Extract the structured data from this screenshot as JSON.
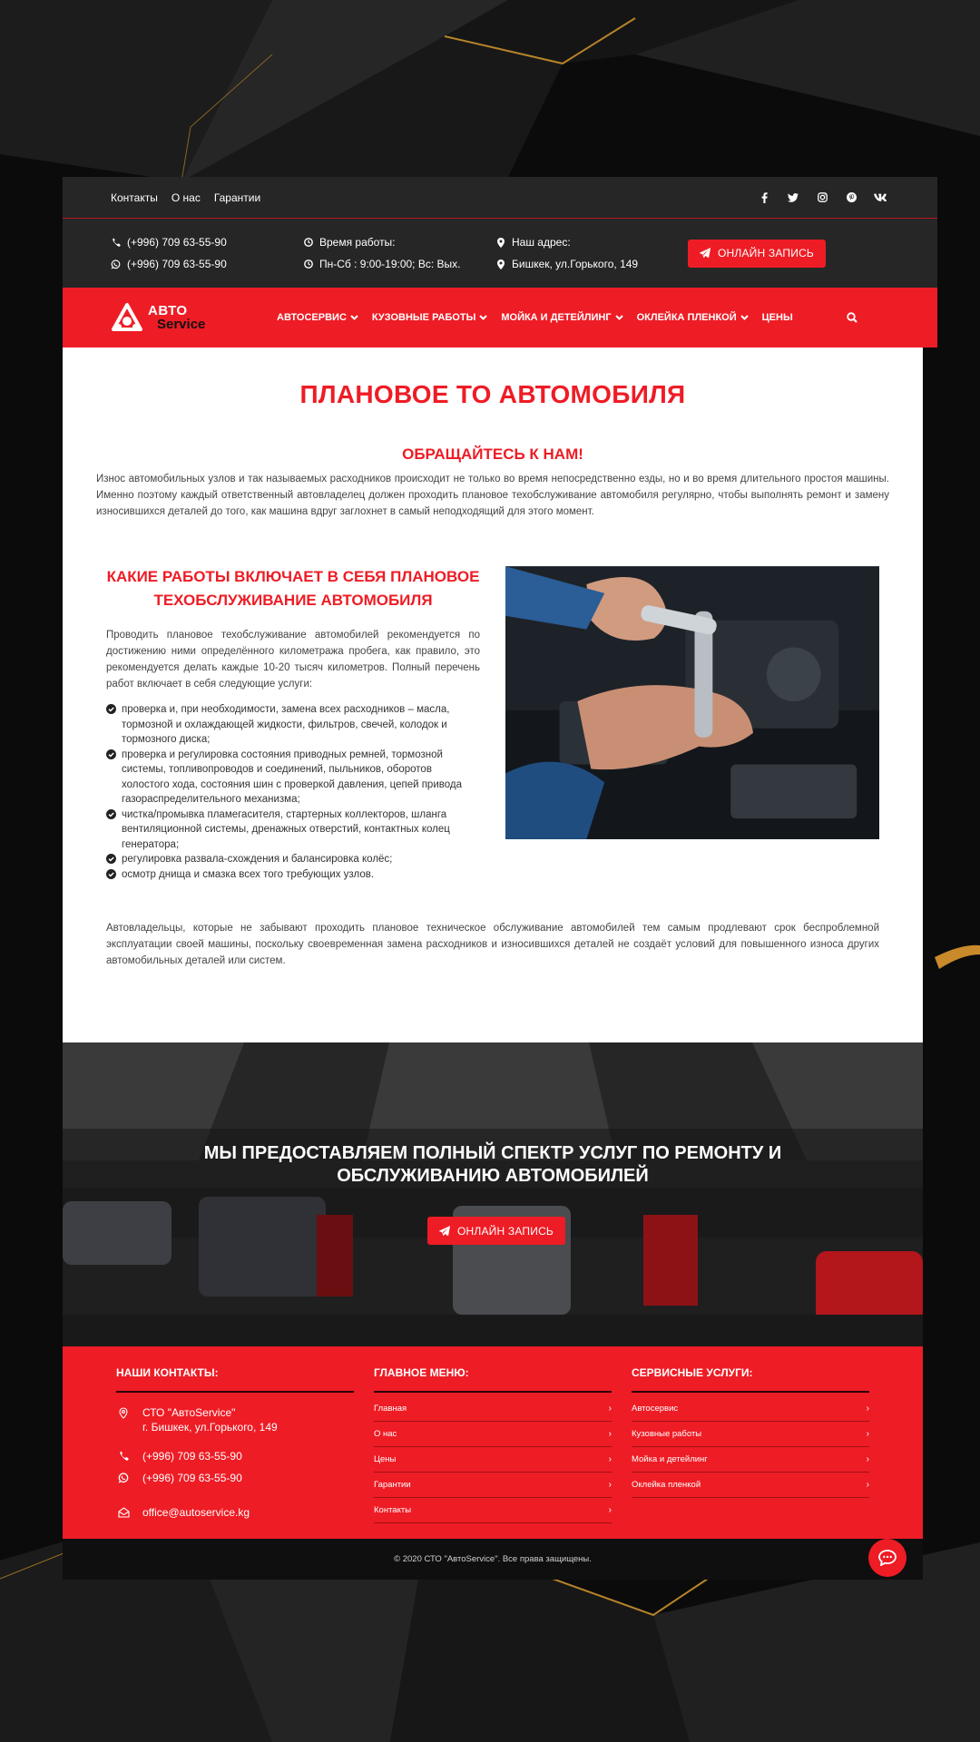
{
  "topbar": {
    "links": [
      "Контакты",
      "О нас",
      "Гарантии"
    ],
    "socials": [
      "facebook-icon",
      "twitter-icon",
      "instagram-icon",
      "pinterest-icon",
      "vk-icon"
    ]
  },
  "info": {
    "phone1": "(+996) 709 63-55-90",
    "phone2": "(+996) 709 63-55-90",
    "hours_label": "Время работы:",
    "hours_value": "Пн-Сб : 9:00-19:00; Вс: Вых.",
    "address_label": "Наш адрес:",
    "address_value": "Бишкек, ул.Горького, 149",
    "booking_button": "ОНЛАЙН ЗАПИСЬ"
  },
  "logo": {
    "line1": "АВТО",
    "line2": "Service"
  },
  "nav": {
    "items": [
      "АВТОСЕРВИС",
      "КУЗОВНЫЕ РАБОТЫ",
      "МОЙКА И ДЕТЕЙЛИНГ",
      "ОКЛЕЙКА ПЛЕНКОЙ",
      "ЦЕНЫ"
    ]
  },
  "content": {
    "title": "ПЛАНОВОЕ ТО АВТОМОБИЛЯ",
    "subtitle": "ОБРАЩАЙТЕСЬ К НАМ!",
    "intro": "Износ автомобильных узлов и так называемых расходников происходит не только во время непосредственно езды, но и во время длительного простоя машины. Именно поэтому каждый ответственный автовладелец должен проходить плановое техобслуживание автомобиля регулярно, чтобы выполнять ремонт и замену износившихся деталей до того, как машина вдруг заглохнет в самый неподходящий для этого момент.",
    "section_title_1": "КАКИЕ РАБОТЫ ВКЛЮЧАЕТ В СЕБЯ ПЛАНОВОЕ",
    "section_title_2": "ТЕХОБСЛУЖИВАНИЕ АВТОМОБИЛЯ",
    "section_text": "Проводить плановое техобслуживание автомобилей рекомендуется по достижению ними определённого километража пробега, как правило, это рекомендуется делать каждые 10-20 тысяч километров. Полный перечень работ включает в себя следующие услуги:",
    "checklist": [
      "проверка и, при необходимости, замена всех расходников – масла, тормозной и охлаждающей жидкости, фильтров, свечей, колодок и тормозного диска;",
      "проверка и регулировка состояния приводных ремней, тормозной системы, топливопроводов и соединений, пыльников, оборотов холостого хода, состояния шин с проверкой давления, цепей привода газораспределительного механизма;",
      "чистка/промывка пламегасителя, стартерных коллекторов, шланга вентиляционной системы, дренажных отверстий, контактных колец генератора;",
      "регулировка развала-схождения и балансировка колёс;",
      "осмотр днища и смазка всех того требующих узлов."
    ],
    "outro": "Автовладельцы, которые не забывают проходить плановое техническое обслуживание автомобилей тем самым продлевают срок беспроблемной эксплуатации своей машины, поскольку своевременная замена расходников и износившихся деталей не создаёт условий для повышенного износа других автомобильных деталей или систем."
  },
  "cta": {
    "line1": "МЫ ПРЕДОСТАВЛЯЕМ ПОЛНЫЙ СПЕКТР УСЛУГ ПО РЕМОНТУ И",
    "line2": "ОБСЛУЖИВАНИЮ АВТОМОБИЛЕЙ",
    "button": "ОНЛАЙН ЗАПИСЬ"
  },
  "footer": {
    "contacts_title": "НАШИ КОНТАКТЫ:",
    "company": "СТО \"АвтоService\"",
    "address": "г. Бишкек, ул.Горького, 149",
    "phone1": "(+996) 709 63-55-90",
    "phone2": "(+996) 709 63-55-90",
    "email": "office@autoservice.kg",
    "menu_title": "ГЛАВНОЕ МЕНЮ:",
    "menu_items": [
      "Главная",
      "О нас",
      "Цены",
      "Гарантии",
      "Контакты"
    ],
    "services_title": "СЕРВИСНЫЕ УСЛУГИ:",
    "service_items": [
      "Автосервис",
      "Кузовные работы",
      "Мойка и детейлинг",
      "Оклейка пленкой"
    ]
  },
  "copyright": "© 2020 СТО \"АвтоService\". Все права защищены.",
  "colors": {
    "accent": "#ee1c25",
    "dark": "#262626",
    "background": "#0d0d0d"
  }
}
